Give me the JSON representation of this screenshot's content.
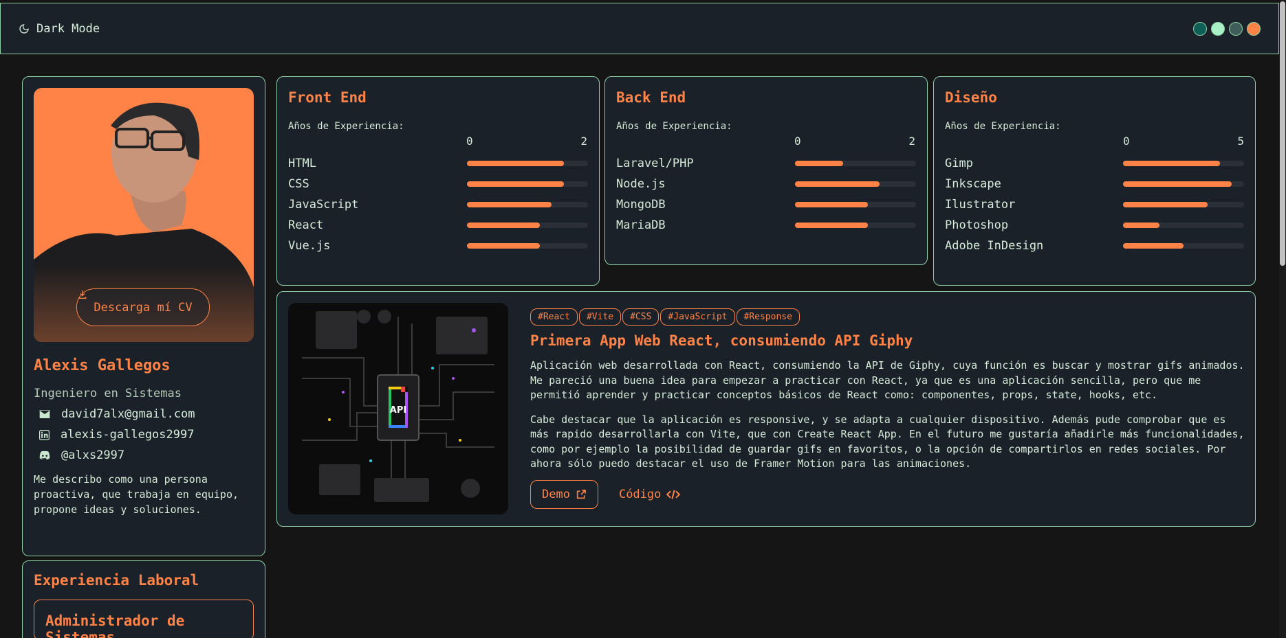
{
  "header": {
    "dark_mode_label": "Dark Mode",
    "theme_colors": [
      "#0f5f57",
      "#a8f0c6",
      "#3f5e5a",
      "#ff8346"
    ]
  },
  "profile": {
    "cv_button": "Descarga mí CV",
    "name": "Alexis Gallegos",
    "role": "Ingeniero en Sistemas",
    "email": "david7alx@gmail.com",
    "linkedin": "alexis-gallegos2997",
    "github": "@alxs2997",
    "description": "Me describo como una persona proactiva, que trabaja en equipo, propone ideas y soluciones."
  },
  "experience": {
    "title": "Experiencia Laboral",
    "items": [
      {
        "title": "Administrador de Sistemas"
      }
    ]
  },
  "skills": [
    {
      "title": "Front End",
      "years_label": "Años de Experiencia:",
      "scale_min": "0",
      "scale_max": "2",
      "items": [
        {
          "name": "HTML",
          "level": 0.8
        },
        {
          "name": "CSS",
          "level": 0.8
        },
        {
          "name": "JavaScript",
          "level": 0.7
        },
        {
          "name": "React",
          "level": 0.6
        },
        {
          "name": "Vue.js",
          "level": 0.6
        }
      ]
    },
    {
      "title": "Back End",
      "years_label": "Años de Experiencia:",
      "scale_min": "0",
      "scale_max": "2",
      "items": [
        {
          "name": "Laravel/PHP",
          "level": 0.4
        },
        {
          "name": "Node.js",
          "level": 0.7
        },
        {
          "name": "MongoDB",
          "level": 0.6
        },
        {
          "name": "MariaDB",
          "level": 0.6
        }
      ]
    },
    {
      "title": "Diseño",
      "years_label": "Años de Experiencia:",
      "scale_min": "0",
      "scale_max": "5",
      "items": [
        {
          "name": "Gimp",
          "level": 0.8
        },
        {
          "name": "Inkscape",
          "level": 0.9
        },
        {
          "name": "Ilustrator",
          "level": 0.7
        },
        {
          "name": "Photoshop",
          "level": 0.3
        },
        {
          "name": "Adobe InDesign",
          "level": 0.5
        }
      ]
    }
  ],
  "project": {
    "tags": [
      "#React",
      "#Vite",
      "#CSS",
      "#JavaScript",
      "#Response"
    ],
    "title": "Primera App Web React, consumiendo API Giphy",
    "paragraph1": "Aplicación web desarrollada con React, consumiendo la API de Giphy, cuya función es buscar y mostrar gifs animados. Me pareció una buena idea para empezar a practicar con React, ya que es una aplicación sencilla, pero que me permitió aprender y practicar conceptos básicos de React como: componentes, props, state, hooks, etc.",
    "paragraph2": "Cabe destacar que la aplicación es responsive, y se adapta a cualquier dispositivo. Además pude comprobar que es más rapido desarrollarla con Vite, que con Create React App. En el futuro me gustaría añadirle más funcionalidades, como por ejemplo la posibilidad de guardar gifs en favoritos, o la opción de compartirlos en redes sociales. Por ahora sólo puedo destacar el uso de Framer Motion para las animaciones.",
    "image_label": "API",
    "demo_label": "Demo",
    "code_label": "Código"
  }
}
